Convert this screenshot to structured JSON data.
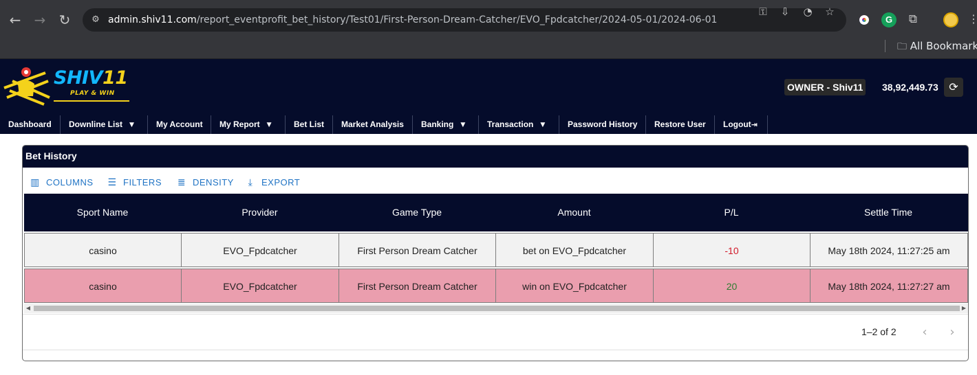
{
  "browser": {
    "url_host": "admin.shiv11.com",
    "url_path": "/report_eventprofit_bet_history/Test01/First-Person-Dream-Catcher/EVO_Fpdcatcher/2024-05-01/2024-06-01",
    "bookmarks_label": "All Bookmarks"
  },
  "brand": {
    "name_part1": "SHIV",
    "name_part2": "11",
    "tagline": "PLAY & WIN"
  },
  "header": {
    "owner_label": "OWNER - Shiv11",
    "balance": "38,92,449.73"
  },
  "nav": {
    "items": [
      {
        "label": "Dashboard"
      },
      {
        "label": "Downline List"
      },
      {
        "label": "My Account"
      },
      {
        "label": "My Report"
      },
      {
        "label": "Bet List"
      },
      {
        "label": "Market Analysis"
      },
      {
        "label": "Banking"
      },
      {
        "label": "Transaction"
      },
      {
        "label": "Password History"
      },
      {
        "label": "Restore User"
      },
      {
        "label": "Logout"
      }
    ]
  },
  "panel": {
    "title": "Bet History",
    "toolbar": {
      "columns": "COLUMNS",
      "filters": "FILTERS",
      "density": "DENSITY",
      "export": "EXPORT"
    },
    "columns": [
      "Sport Name",
      "Provider",
      "Game Type",
      "Amount",
      "P/L",
      "Settle Time"
    ],
    "rows": [
      [
        "casino",
        "EVO_Fpdcatcher",
        "First Person Dream Catcher",
        "bet on EVO_Fpdcatcher",
        "-10",
        "May 18th 2024, 11:27:25 am"
      ],
      [
        "casino",
        "EVO_Fpdcatcher",
        "First Person Dream Catcher",
        "win on EVO_Fpdcatcher",
        "20",
        "May 18th 2024, 11:27:27 am"
      ]
    ],
    "pagination": "1–2 of 2"
  },
  "colors": {
    "header_bg": "#050c2b",
    "accent_blue": "#1f73c4",
    "win_row": "#ea9eae",
    "loss_text": "#d11a2a",
    "profit_text": "#2e7d32"
  }
}
